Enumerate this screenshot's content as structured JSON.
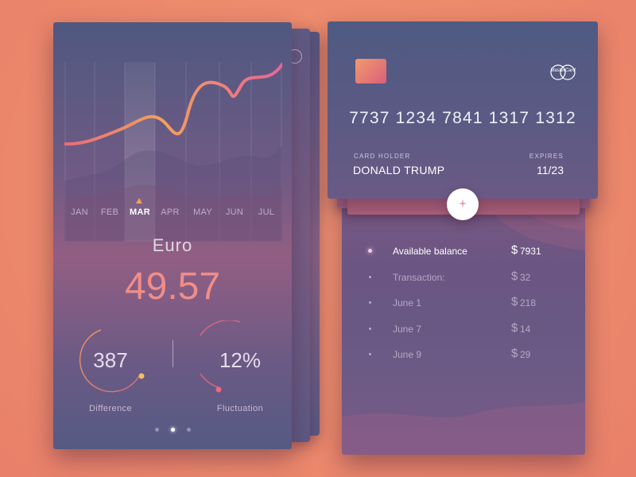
{
  "chart": {
    "months": [
      "JAN",
      "FEB",
      "MAR",
      "APR",
      "MAY",
      "JUN",
      "JUL"
    ],
    "active_month": "MAR",
    "accent": "#f2a05a"
  },
  "currency": {
    "name": "Euro",
    "rate": "49.57"
  },
  "stats": {
    "difference": {
      "value": "387",
      "label": "Difference"
    },
    "fluctuation": {
      "value": "12%",
      "label": "Fluctuation"
    }
  },
  "pagination": {
    "pages": 3,
    "active": 1
  },
  "credit_card": {
    "number": "7737 1234 7841 1317 1312",
    "holder_label": "CARD  HOLDER",
    "holder_name": "DONALD TRUMP",
    "expires_label": "EXPIRES",
    "expires": "11/23",
    "brand": "MasterCard",
    "brand_icon": "mastercard-icon"
  },
  "add_button": {
    "label": "+"
  },
  "transactions": [
    {
      "label": "Available balance",
      "currency": "$",
      "amount": "7931",
      "active": true
    },
    {
      "label": "Transaction:",
      "currency": "$",
      "amount": "32",
      "active": false
    },
    {
      "label": "June 1",
      "currency": "$",
      "amount": "218",
      "active": false
    },
    {
      "label": "June 7",
      "currency": "$",
      "amount": "14",
      "active": false
    },
    {
      "label": "June 9",
      "currency": "$",
      "amount": "29",
      "active": false
    }
  ]
}
